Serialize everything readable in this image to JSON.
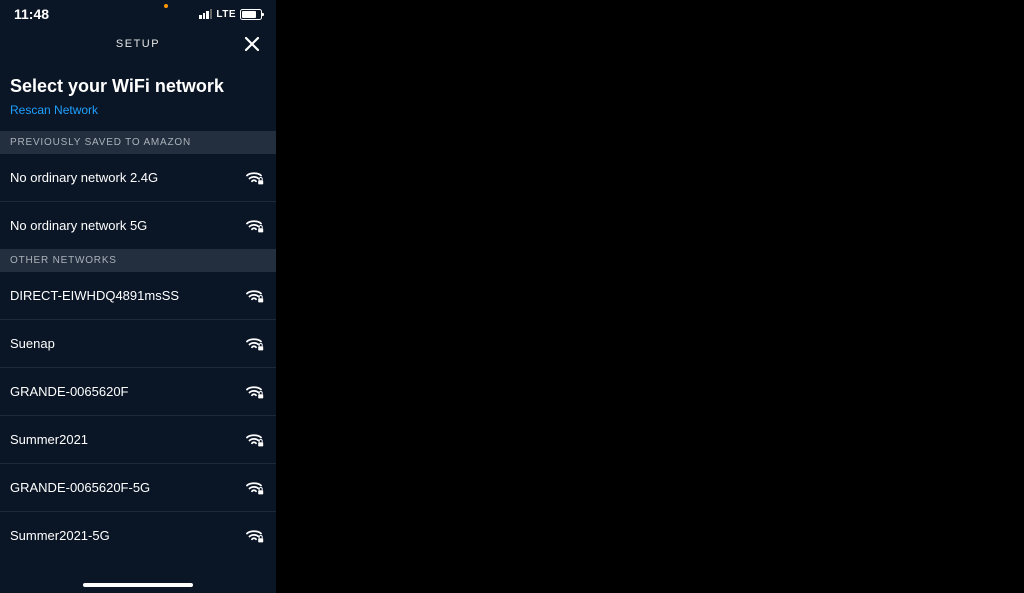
{
  "status_bar": {
    "time": "11:48",
    "carrier_label": "LTE"
  },
  "nav": {
    "title": "SETUP"
  },
  "page": {
    "heading": "Select your WiFi network",
    "rescan_label": "Rescan Network"
  },
  "sections": {
    "saved_header": "PREVIOUSLY SAVED TO AMAZON",
    "other_header": "OTHER NETWORKS"
  },
  "saved_networks": [
    {
      "name": "No ordinary network 2.4G"
    },
    {
      "name": "No ordinary network 5G"
    }
  ],
  "other_networks": [
    {
      "name": "DIRECT-EIWHDQ4891msSS"
    },
    {
      "name": "Suenap"
    },
    {
      "name": "GRANDE-0065620F"
    },
    {
      "name": "Summer2021"
    },
    {
      "name": "GRANDE-0065620F-5G"
    },
    {
      "name": "Summer2021-5G"
    }
  ]
}
